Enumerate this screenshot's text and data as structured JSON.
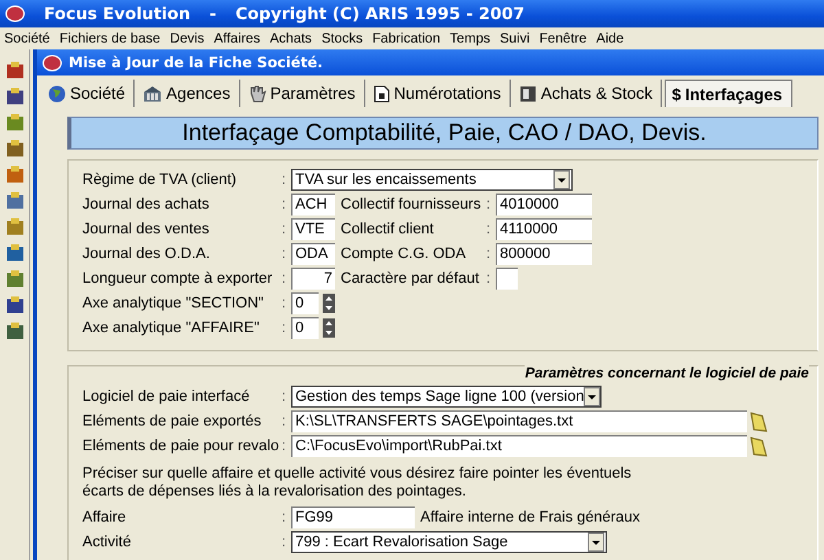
{
  "app": {
    "title": "Focus Evolution",
    "separator": "-",
    "copyright": "Copyright (C) ARIS 1995 - 2007"
  },
  "menu": [
    "Société",
    "Fichiers de base",
    "Devis",
    "Affaires",
    "Achats",
    "Stocks",
    "Fabrication",
    "Temps",
    "Suivi",
    "Fenêtre",
    "Aide"
  ],
  "window": {
    "title": "Mise à Jour de la Fiche Société."
  },
  "tabs": [
    {
      "label": "Société",
      "kind": "globe",
      "selected": false
    },
    {
      "label": "Agences",
      "kind": "building",
      "selected": false
    },
    {
      "label": "Paramètres",
      "kind": "hand",
      "selected": false
    },
    {
      "label": "Numérotations",
      "kind": "document",
      "selected": false
    },
    {
      "label": "Achats & Stock",
      "kind": "ledger",
      "selected": false
    },
    {
      "label": "Interfaçages",
      "kind": "symbol",
      "symbol": "$",
      "selected": true
    }
  ],
  "heading": "Interfaçage Comptabilité, Paie, CAO / DAO, Devis.",
  "accounting": {
    "vat": {
      "label": "Règime de TVA (client)",
      "sep": ":",
      "value": "TVA sur les encaissements"
    },
    "journals": [
      {
        "label": "Journal des achats",
        "sep": ":",
        "value": "ACH",
        "account_label": "Collectif fournisseurs",
        "account_sep": ":",
        "account_value": "4010000"
      },
      {
        "label": "Journal des ventes",
        "sep": ":",
        "value": "VTE",
        "account_label": "Collectif client",
        "account_sep": ":",
        "account_value": "4110000"
      },
      {
        "label": "Journal des O.D.A.",
        "sep": ":",
        "value": "ODA",
        "account_label": "Compte C.G. ODA",
        "account_sep": ":",
        "account_value": "800000"
      }
    ],
    "length": {
      "label": "Longueur compte à exporter",
      "sep": ":",
      "value": "7",
      "char_label": "Caractère par défaut",
      "char_sep": ":"
    },
    "axes": [
      {
        "label": "Axe analytique \"SECTION\"",
        "sep": ":",
        "value": "0"
      },
      {
        "label": "Axe analytique \"AFFAIRE\"",
        "sep": ":",
        "value": "0"
      }
    ]
  },
  "payroll": {
    "legend": "Paramètres concernant le logiciel de paie",
    "software": {
      "label": "Logiciel de paie interfacé",
      "sep": ":",
      "value": "Gestion des temps Sage ligne 100 (version"
    },
    "paths": [
      {
        "label": "Eléments de paie exportés",
        "sep": ":",
        "value": "K:\\SL\\TRANSFERTS SAGE\\pointages.txt"
      },
      {
        "label": "Eléments de paie pour revalo",
        "sep": ":",
        "value": "C:\\FocusEvo\\import\\RubPai.txt"
      }
    ],
    "note": "Préciser sur quelle affaire et quelle activité vous désirez faire pointer les éventuels écarts de dépenses liés à la revalorisation des pointages.",
    "affaire": {
      "label": "Affaire",
      "sep": ":",
      "value": "FG99",
      "description": "Affaire interne de Frais généraux"
    },
    "activite": {
      "label": "Activité",
      "sep": ":",
      "value": "799 : Ecart Revalorisation Sage"
    }
  }
}
